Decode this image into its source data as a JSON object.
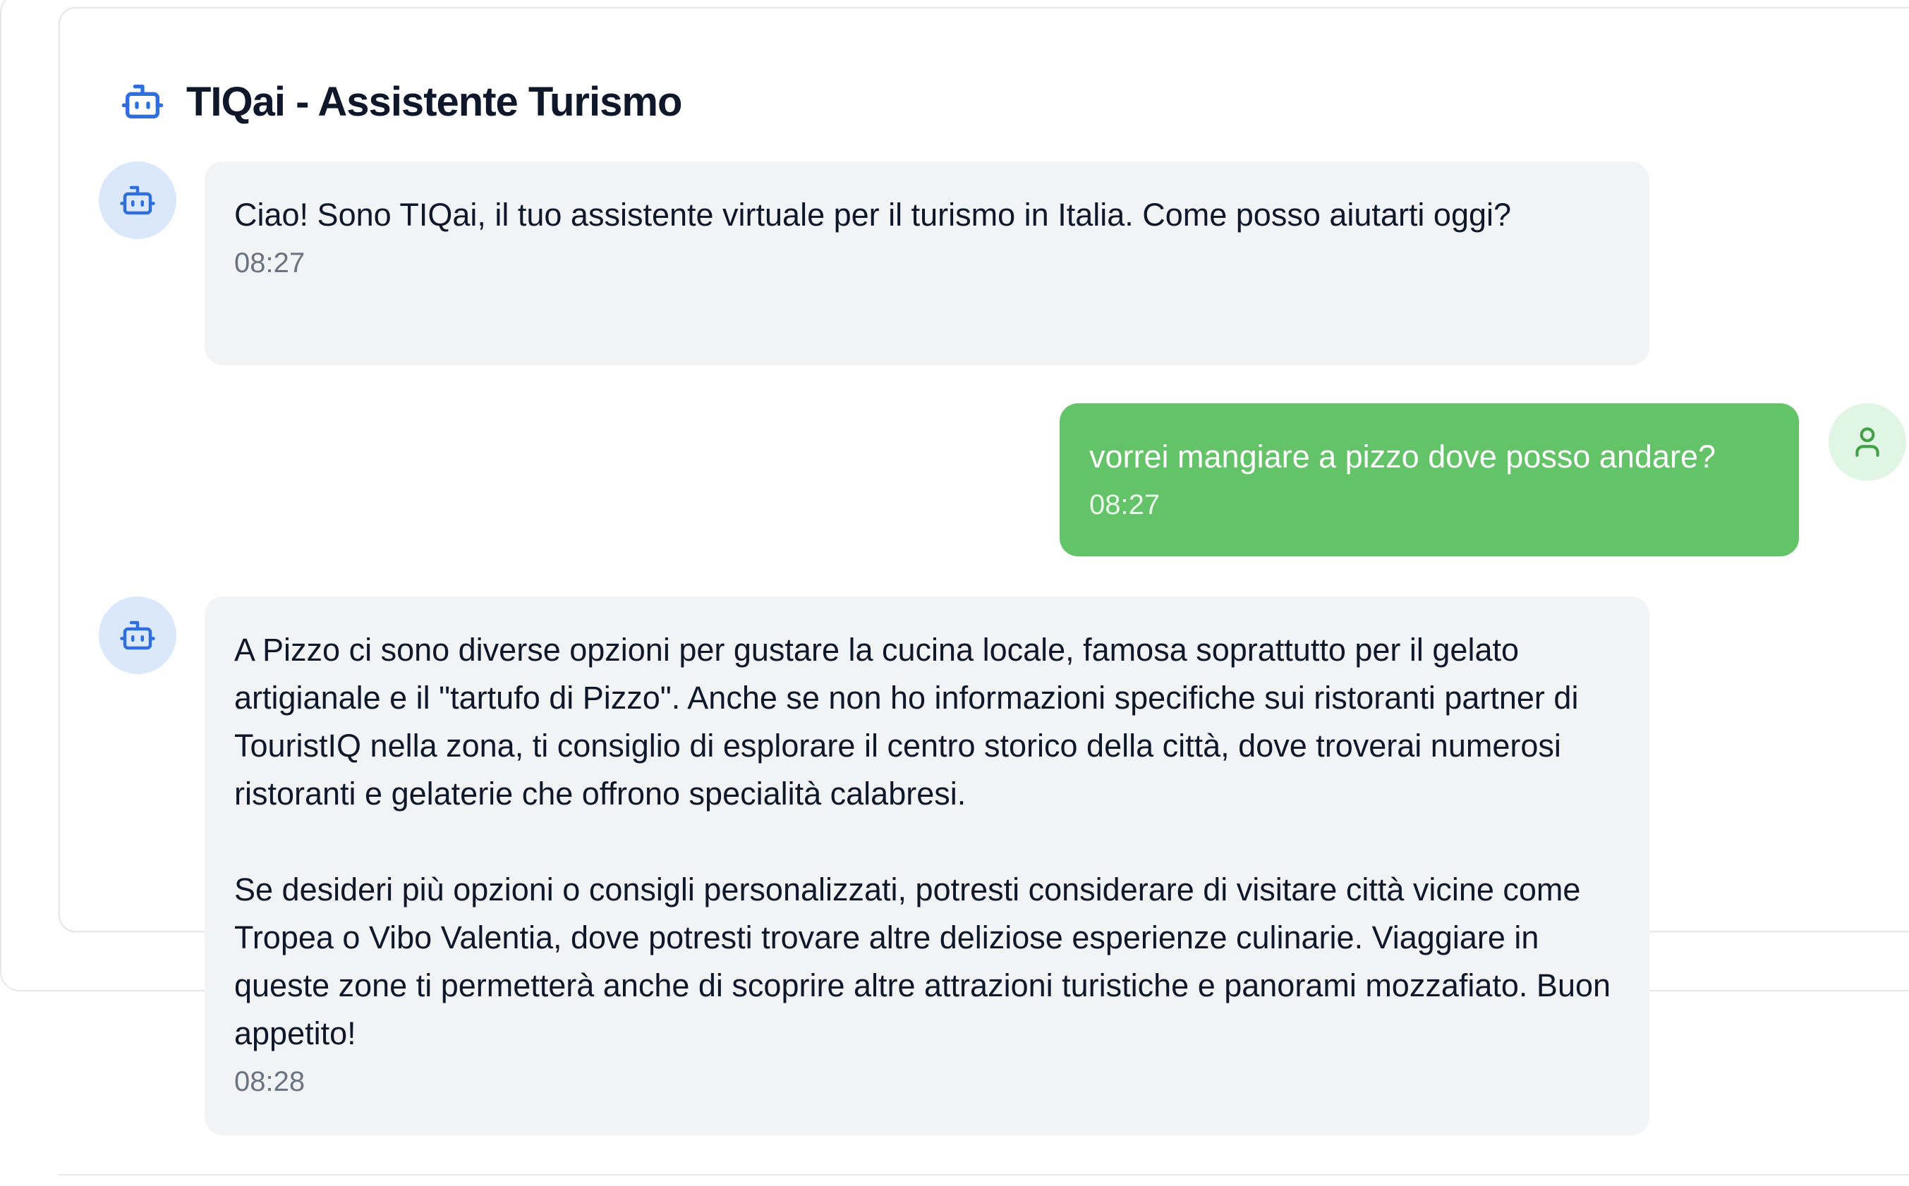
{
  "header": {
    "title": "TIQai - Assistente Turismo",
    "icon": "bot-icon",
    "accent_color": "#2f6fdc"
  },
  "messages": [
    {
      "role": "assistant",
      "avatar_icon": "bot-icon",
      "text": "Ciao! Sono TIQai, il tuo assistente virtuale per il turismo in Italia. Come posso aiutarti oggi?",
      "time": "08:27"
    },
    {
      "role": "user",
      "avatar_icon": "user-icon",
      "text": "vorrei mangiare a pizzo dove posso andare?",
      "time": "08:27"
    },
    {
      "role": "assistant",
      "avatar_icon": "bot-icon",
      "text": "A Pizzo ci sono diverse opzioni per gustare la cucina locale, famosa soprattutto per il gelato artigianale e il \"tartufo di Pizzo\". Anche se non ho informazioni specifiche sui ristoranti partner di TouristIQ nella zona, ti consiglio di esplorare il centro storico della città, dove troverai numerosi ristoranti e gelaterie che offrono specialità calabresi.\n\nSe desideri più opzioni o consigli personalizzati, potresti considerare di visitare città vicine come Tropea o Vibo Valentia, dove potresti trovare altre deliziose esperienze culinarie. Viaggiare in queste zone ti permetterà anche di scoprire altre attrazioni turistiche e panorami mozzafiato. Buon appetito!",
      "time": "08:28"
    }
  ],
  "colors": {
    "bot_bubble": "#f2f3f5",
    "user_bubble": "#64c268",
    "bot_avatar_bg": "#dbe8fb",
    "user_avatar_bg": "#e1f5e4"
  }
}
